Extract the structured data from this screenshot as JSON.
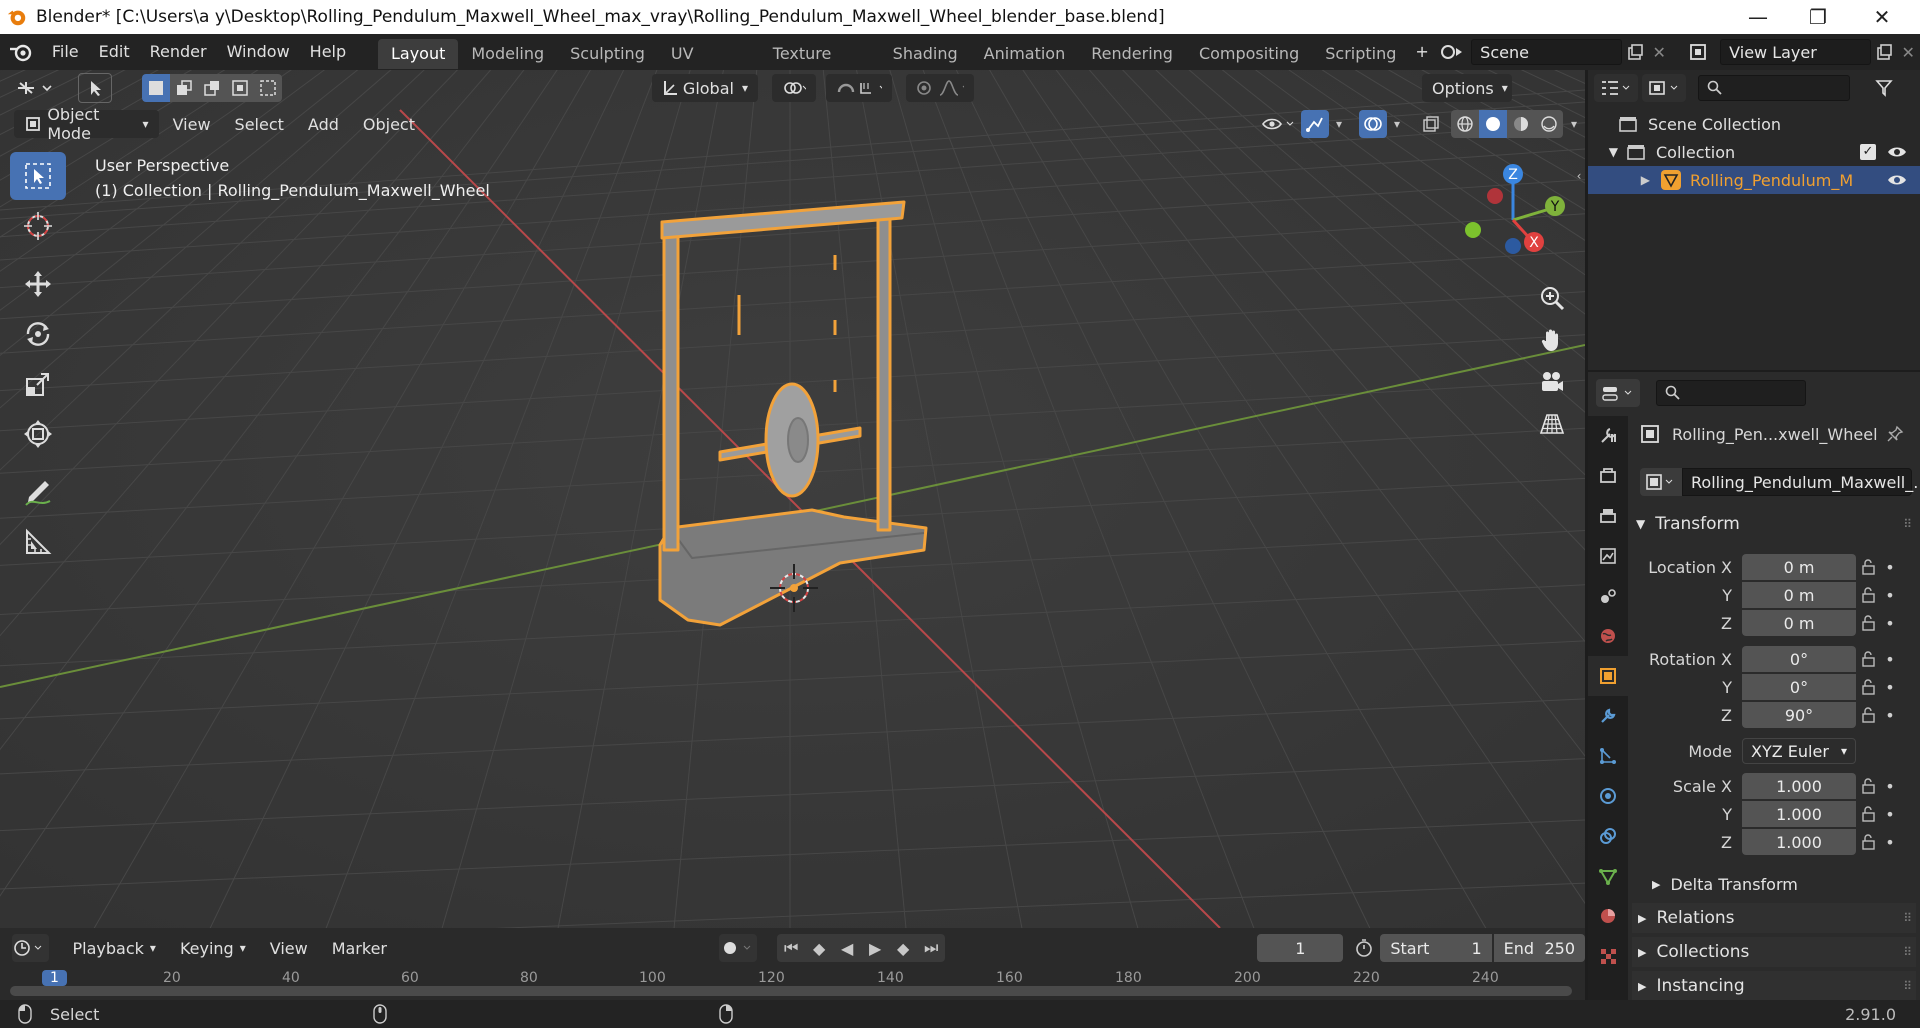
{
  "window": {
    "title": "Blender* [C:\\Users\\a y\\Desktop\\Rolling_Pendulum_Maxwell_Wheel_max_vray\\Rolling_Pendulum_Maxwell_Wheel_blender_base.blend]",
    "minimize": "—",
    "maximize": "❐",
    "close": "✕"
  },
  "menu": [
    "File",
    "Edit",
    "Render",
    "Window",
    "Help"
  ],
  "workspaces": [
    {
      "label": "Layout",
      "active": true
    },
    {
      "label": "Modeling",
      "active": false
    },
    {
      "label": "Sculpting",
      "active": false
    },
    {
      "label": "UV Editing",
      "active": false
    },
    {
      "label": "Texture Paint",
      "active": false
    },
    {
      "label": "Shading",
      "active": false
    },
    {
      "label": "Animation",
      "active": false
    },
    {
      "label": "Rendering",
      "active": false
    },
    {
      "label": "Compositing",
      "active": false
    },
    {
      "label": "Scripting",
      "active": false
    }
  ],
  "add_workspace": "+",
  "scene": {
    "name": "Scene",
    "view_layer": "View Layer"
  },
  "viewport": {
    "transform_orientation": "Global",
    "options_label": "Options",
    "mode": "Object Mode",
    "header_menus": [
      "View",
      "Select",
      "Add",
      "Object"
    ],
    "info_line1": "User Perspective",
    "info_line2": "(1) Collection | Rolling_Pendulum_Maxwell_Wheel",
    "gizmo": {
      "z": "Z",
      "y": "Y",
      "x": "X"
    }
  },
  "outliner": {
    "scene_collection": "Scene Collection",
    "collection": "Collection",
    "object": "Rolling_Pendulum_M"
  },
  "properties": {
    "object_name": "Rolling_Pen...xwell_Wheel",
    "data_name": "Rolling_Pendulum_Maxwell_...",
    "transform_header": "Transform",
    "location": {
      "label": "Location X",
      "x": "0 m",
      "y": "0 m",
      "z": "0 m"
    },
    "rotation": {
      "label": "Rotation X",
      "x": "0°",
      "y": "0°",
      "z": "90°"
    },
    "mode_label": "Mode",
    "mode_value": "XYZ Euler",
    "scale": {
      "label": "Scale X",
      "x": "1.000",
      "y": "1.000",
      "z": "1.000"
    },
    "axis_y": "Y",
    "axis_z": "Z",
    "delta_transform": "Delta Transform",
    "relations": "Relations",
    "collections": "Collections",
    "instancing": "Instancing"
  },
  "timeline": {
    "menus": [
      "Playback",
      "Keying",
      "View",
      "Marker"
    ],
    "current_frame": "1",
    "start_label": "Start",
    "start_value": "1",
    "end_label": "End",
    "end_value": "250",
    "ruler": [
      "1",
      "20",
      "40",
      "60",
      "80",
      "100",
      "120",
      "140",
      "160",
      "180",
      "200",
      "220",
      "240"
    ]
  },
  "status": {
    "select": "Select",
    "version": "2.91.0"
  },
  "colors": {
    "accent": "#4772b3",
    "selection": "#f0a030",
    "x_axis": "#e0413f",
    "y_axis": "#7fb23b",
    "z_axis": "#3a86e0"
  }
}
